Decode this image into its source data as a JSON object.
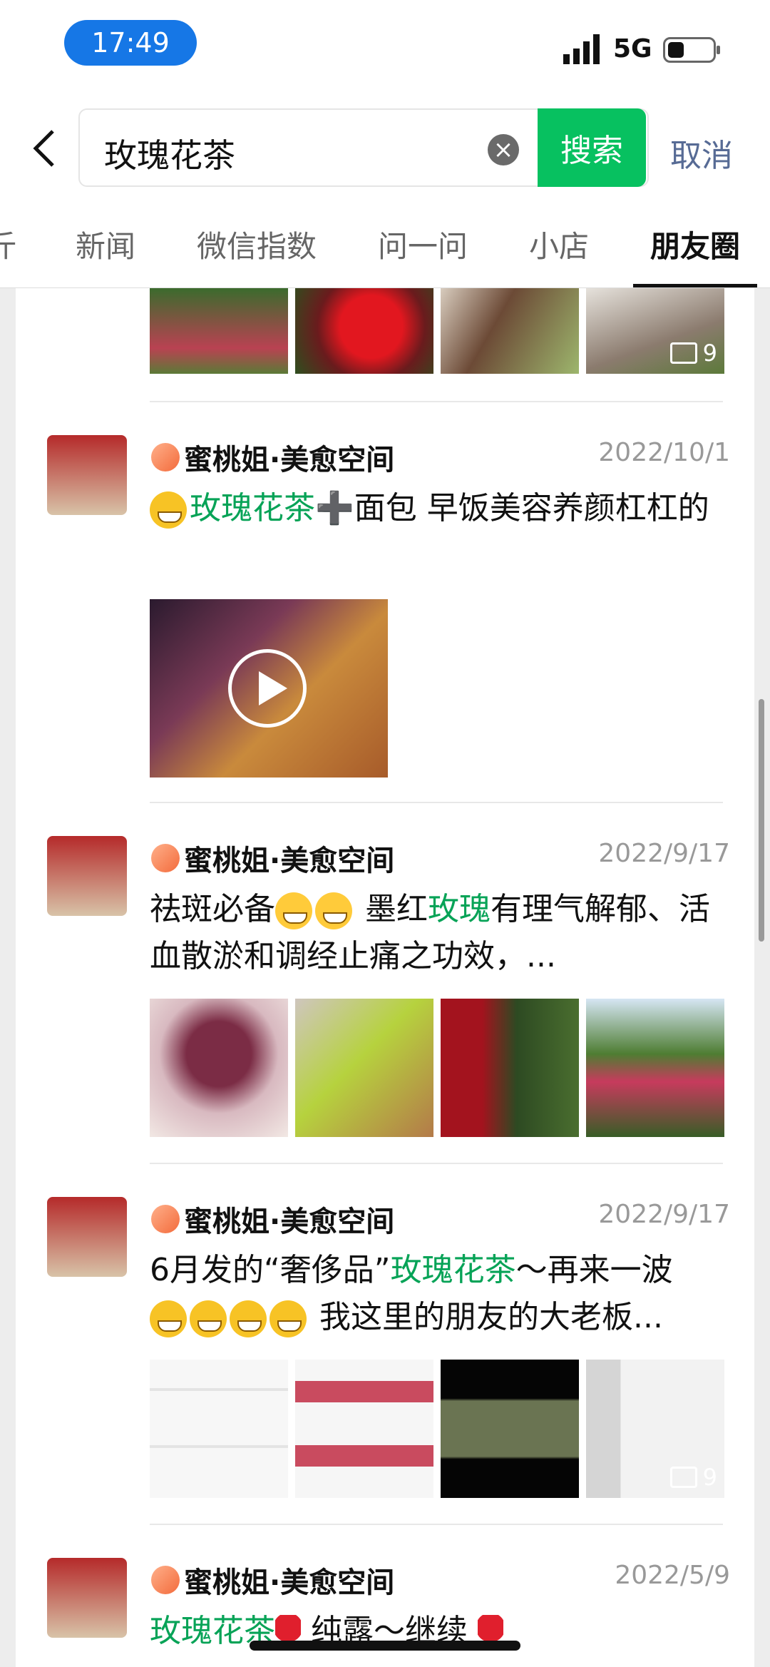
{
  "status": {
    "time": "17:49",
    "network": "5G"
  },
  "search": {
    "query": "玫瑰花茶",
    "button": "搜索",
    "cancel": "取消"
  },
  "tabs": [
    "斤",
    "新闻",
    "微信指数",
    "问一问",
    "小店",
    "朋友圈"
  ],
  "active_tab": "朋友圈",
  "top_images": {
    "count": "9"
  },
  "posts": [
    {
      "author": "蜜桃姐·美愈空间",
      "date": "2022/10/1",
      "text_before": "",
      "highlight": "玫瑰花茶",
      "text_after": "➕面包 早饭美容养颜杠杠的"
    },
    {
      "author": "蜜桃姐·美愈空间",
      "date": "2022/9/17",
      "text_before": "祛斑必备",
      "highlight": "玫瑰",
      "text_mid": " 墨红",
      "text_after": "有理气解郁、活血散淤和调经止痛之功效，..."
    },
    {
      "author": "蜜桃姐·美愈空间",
      "date": "2022/9/17",
      "text_before": "6月发的“奢侈品”",
      "highlight": "玫瑰花茶",
      "text_after": "～再来一波",
      "line2": " 我这里的朋友的大老板...",
      "count": "9"
    },
    {
      "author": "蜜桃姐·美愈空间",
      "date": "2022/5/9",
      "highlight": "玫瑰花茶",
      "text_after": " 纯露～继续"
    }
  ]
}
